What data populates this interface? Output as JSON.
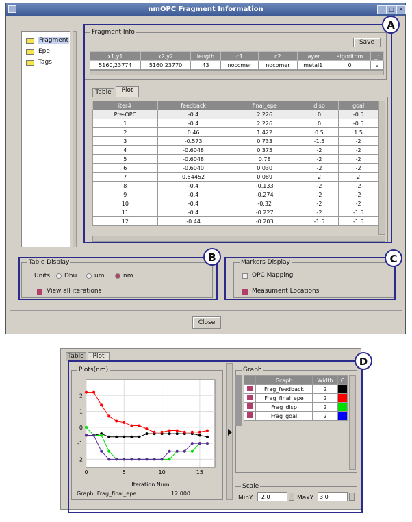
{
  "window": {
    "title": "nmOPC Fragment Information",
    "controls": [
      "_",
      "□",
      "×"
    ]
  },
  "tree": {
    "items": [
      {
        "label": "Fragment",
        "selected": true
      },
      {
        "label": "Epe",
        "selected": false
      },
      {
        "label": "Tags",
        "selected": false
      }
    ]
  },
  "fragment_info": {
    "label": "Fragment Info",
    "save_label": "Save",
    "columns": [
      "x1,y1",
      "x2,y2",
      "length",
      "c1",
      "c2",
      "layer",
      "algorithm",
      "_r"
    ],
    "row": [
      "5160,23774",
      "5160,23770",
      "43",
      "noccmer",
      "nocomer",
      "metal1",
      "0",
      "v"
    ]
  },
  "tabs": {
    "table": "Table",
    "plot": "Plot"
  },
  "iter_table": {
    "columns": [
      "iter#",
      "feedback",
      "final_epe",
      "disp",
      "goal"
    ],
    "rows": [
      [
        "Pre-OPC",
        "-0.4",
        "2.226",
        "0",
        "-0.5"
      ],
      [
        "1",
        "-0.4",
        "2.226",
        "0",
        "-0.5"
      ],
      [
        "2",
        "0.46",
        "1.422",
        "0.5",
        "1.5"
      ],
      [
        "3",
        "-0.573",
        "0.733",
        "-1.5",
        "-2"
      ],
      [
        "4",
        "-0.6048",
        "0.375",
        "-2",
        "-2"
      ],
      [
        "5",
        "-0.6048",
        "0.78",
        "-2",
        "-2"
      ],
      [
        "6",
        "-0.6040",
        "0.030",
        "-2",
        "-2"
      ],
      [
        "7",
        "0.54452",
        "0.089",
        "2",
        "2"
      ],
      [
        "8",
        "-0.4",
        "-0.133",
        "-2",
        "-2"
      ],
      [
        "9",
        "-0.4",
        "-0.274",
        "-2",
        "-2"
      ],
      [
        "10",
        "-0.4",
        "-0.32",
        "-2",
        "-2"
      ],
      [
        "11",
        "-0.4",
        "-0.227",
        "-2",
        "-1.5"
      ],
      [
        "12",
        "-0.44",
        "-0.203",
        "-1.5",
        "-1.5"
      ]
    ]
  },
  "table_display": {
    "label": "Table Display",
    "units_label": "Units:",
    "units": [
      {
        "label": "Dbu",
        "selected": false
      },
      {
        "label": "um",
        "selected": false
      },
      {
        "label": "nm",
        "selected": true
      }
    ],
    "all_iterations": "View all iterations"
  },
  "markers_display": {
    "label": "Markers Display",
    "opc_mapping": "OPC Mapping",
    "measurement": "Measument Locations"
  },
  "close_label": "Close",
  "callouts": {
    "a": "A",
    "b": "B",
    "c": "C",
    "d": "D"
  },
  "plot_panel": {
    "tabs": {
      "table": "Table",
      "plot": "Plot"
    },
    "plot_title": "Plots(nm)",
    "footer_graph": "Graph: Frag_final_epe",
    "footer_value": "12.000",
    "graph_label": "Graph",
    "graph_columns": [
      "",
      "Graph",
      "Width",
      "C"
    ],
    "graphs": [
      {
        "name": "Frag_feedback",
        "width": "2",
        "color": "#000000"
      },
      {
        "name": "Frag_final_epe",
        "width": "2",
        "color": "#ff0000"
      },
      {
        "name": "Frag_disp",
        "width": "2",
        "color": "#00dd00"
      },
      {
        "name": "Frag_goal",
        "width": "2",
        "color": "#0000ff"
      }
    ],
    "scale_label": "Scale",
    "miny_label": "MinY",
    "miny_value": "-2.0",
    "maxy_label": "MaxY",
    "maxy_value": "3.0"
  },
  "chart_data": {
    "type": "line",
    "xlabel": "Iteration Num",
    "ylabel": "",
    "xlim": [
      0,
      17
    ],
    "ylim": [
      -2.5,
      3
    ],
    "xticks": [
      0,
      5,
      10,
      15
    ],
    "yticks": [
      2,
      1,
      0,
      -1,
      -2
    ],
    "series": [
      {
        "color": "#000000",
        "x": [
          0,
          1,
          2,
          3,
          4,
          5,
          6,
          7,
          8,
          9,
          10,
          11,
          12,
          13,
          14,
          15,
          16
        ],
        "y": [
          -0.5,
          -0.5,
          -0.4,
          -0.6,
          -0.6,
          -0.6,
          -0.6,
          -0.6,
          -0.4,
          -0.4,
          -0.4,
          -0.4,
          -0.4,
          -0.4,
          -0.4,
          -0.5,
          -0.6
        ]
      },
      {
        "color": "#ff0000",
        "x": [
          0,
          1,
          2,
          3,
          4,
          5,
          6,
          7,
          8,
          9,
          10,
          11,
          12,
          13,
          14,
          15,
          16
        ],
        "y": [
          2.2,
          2.2,
          1.4,
          0.7,
          0.4,
          0.3,
          0.1,
          0.1,
          -0.1,
          -0.3,
          -0.3,
          -0.2,
          -0.2,
          -0.3,
          -0.3,
          -0.3,
          -0.2
        ]
      },
      {
        "color": "#00dd00",
        "x": [
          0,
          1,
          2,
          3,
          4,
          5,
          6,
          7,
          8,
          9,
          10,
          11,
          12,
          13,
          14,
          15,
          16
        ],
        "y": [
          0,
          -0.5,
          -0.5,
          -1.5,
          -2,
          -2,
          -2,
          -2,
          -2,
          -2,
          -2,
          -2,
          -1.5,
          -1.5,
          -1.5,
          -1,
          -1
        ]
      },
      {
        "color": "#5b2a9e",
        "x": [
          0,
          1,
          2,
          3,
          4,
          5,
          6,
          7,
          8,
          9,
          10,
          11,
          12,
          13,
          14,
          15,
          16
        ],
        "y": [
          -0.5,
          -0.5,
          -1.5,
          -2,
          -2,
          -2,
          -2,
          -2,
          -2,
          -2,
          -2,
          -1.5,
          -1.5,
          -1.5,
          -1,
          -1,
          -1
        ]
      }
    ]
  }
}
